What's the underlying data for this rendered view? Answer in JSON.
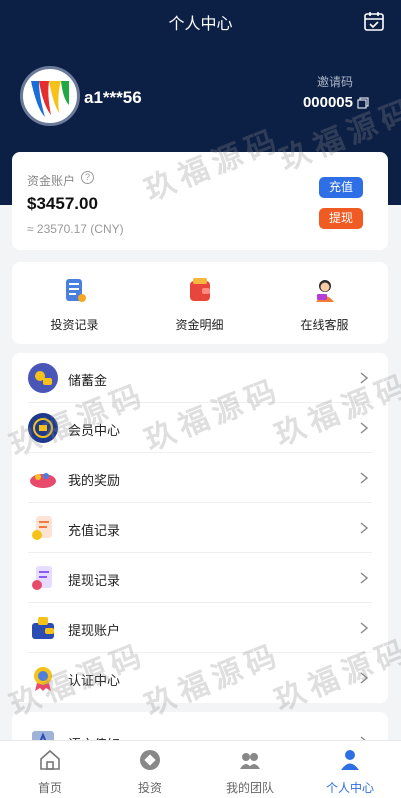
{
  "header": {
    "title": "个人中心",
    "calendar_icon": "calendar-check-icon"
  },
  "profile": {
    "username": "a1***56",
    "invite_label": "邀请码",
    "invite_code": "000005",
    "copy_icon": "copy-icon"
  },
  "account": {
    "label": "资金账户",
    "help_icon": "?",
    "balance": "$3457.00",
    "balance_cny": "≈ 23570.17 (CNY)",
    "recharge_label": "充值",
    "withdraw_label": "提现",
    "recharge_color": "#2f6fe6",
    "withdraw_color": "#f05a23"
  },
  "quick": [
    {
      "label": "投资记录",
      "icon": "scroll-icon"
    },
    {
      "label": "资金明细",
      "icon": "wallet-icon"
    },
    {
      "label": "在线客服",
      "icon": "support-agent-icon"
    }
  ],
  "menu": [
    {
      "label": "储蓄金",
      "icon": "savings-icon"
    },
    {
      "label": "会员中心",
      "icon": "vip-badge-icon"
    },
    {
      "label": "我的奖励",
      "icon": "reward-icon"
    },
    {
      "label": "充值记录",
      "icon": "recharge-record-icon"
    },
    {
      "label": "提现记录",
      "icon": "withdraw-record-icon"
    },
    {
      "label": "提现账户",
      "icon": "withdraw-account-icon"
    },
    {
      "label": "认证中心",
      "icon": "certification-icon"
    }
  ],
  "menu2": [
    {
      "label": "语言偏好",
      "icon": "language-icon"
    }
  ],
  "tabs": [
    {
      "label": "首页",
      "icon": "home-icon"
    },
    {
      "label": "投资",
      "icon": "invest-icon"
    },
    {
      "label": "我的团队",
      "icon": "team-icon"
    },
    {
      "label": "个人中心",
      "icon": "profile-icon",
      "active": true
    }
  ],
  "watermark": "玖福源码",
  "colors": {
    "header_bg": "#0c1f44",
    "accent": "#2f6fe6",
    "page_bg": "#f3f4f6"
  }
}
